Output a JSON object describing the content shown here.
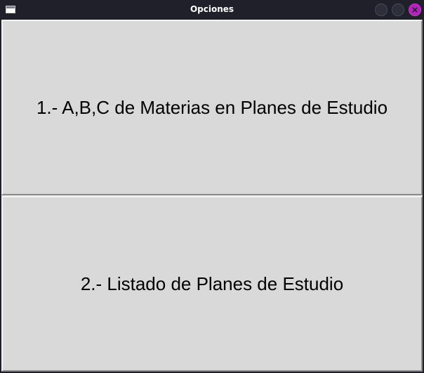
{
  "window": {
    "title": "Opciones",
    "close_glyph": "×",
    "accent_close_color": "#b025b8"
  },
  "icons": {
    "app": "window-icon",
    "minimize": "minimize-icon",
    "maximize": "maximize-icon",
    "close": "close-icon"
  },
  "buttons": [
    {
      "label": "1.- A,B,C de Materias en Planes de Estudio"
    },
    {
      "label": "2.- Listado de Planes de Estudio"
    }
  ]
}
